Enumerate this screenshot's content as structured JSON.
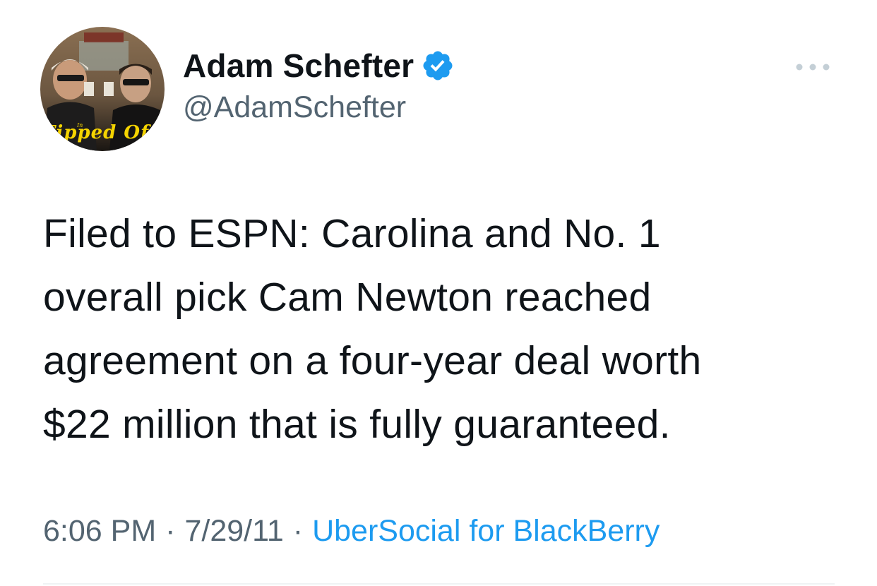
{
  "author": {
    "display_name": "Adam Schefter",
    "handle": "@AdamSchefter",
    "verified": true,
    "avatar_caption": "Tipped Off",
    "avatar_caption_small": "In"
  },
  "menu": {
    "icon": "more-horizontal-icon"
  },
  "tweet": {
    "text": "Filed to ESPN: Carolina and No. 1\noverall pick Cam Newton reached\nagreement on a four-year deal worth\n$22 million that is fully guaranteed."
  },
  "meta": {
    "time": "6:06 PM",
    "separator": "·",
    "date": "7/29/11",
    "source": "UberSocial for BlackBerry"
  },
  "colors": {
    "text": "#0f1419",
    "secondary": "#536471",
    "link": "#1d9bf0",
    "verified": "#1d9bf0"
  }
}
